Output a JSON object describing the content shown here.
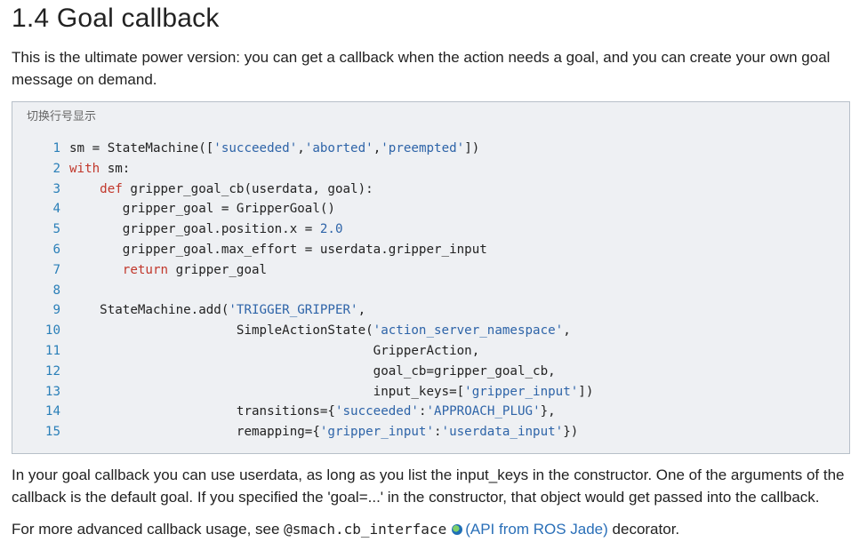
{
  "heading": "1.4 Goal callback",
  "intro": "This is the ultimate power version: you can get a callback when the action needs a goal, and you can create your own goal message on demand.",
  "code_toggle": "切换行号显示",
  "code_lines": [
    {
      "n": "1",
      "tokens": [
        [
          "t",
          "sm = StateMachine(["
        ],
        [
          "s",
          "'succeeded'"
        ],
        [
          "t",
          ","
        ],
        [
          "s",
          "'aborted'"
        ],
        [
          "t",
          ","
        ],
        [
          "s",
          "'preempted'"
        ],
        [
          "t",
          "])"
        ]
      ]
    },
    {
      "n": "2",
      "tokens": [
        [
          "k",
          "with"
        ],
        [
          "t",
          " sm:"
        ]
      ]
    },
    {
      "n": "3",
      "tokens": [
        [
          "t",
          "    "
        ],
        [
          "k",
          "def"
        ],
        [
          "t",
          " gripper_goal_cb(userdata, goal):"
        ]
      ]
    },
    {
      "n": "4",
      "tokens": [
        [
          "t",
          "       gripper_goal = GripperGoal()"
        ]
      ]
    },
    {
      "n": "5",
      "tokens": [
        [
          "t",
          "       gripper_goal.position.x = "
        ],
        [
          "n",
          "2.0"
        ]
      ]
    },
    {
      "n": "6",
      "tokens": [
        [
          "t",
          "       gripper_goal.max_effort = userdata.gripper_input"
        ]
      ]
    },
    {
      "n": "7",
      "tokens": [
        [
          "t",
          "       "
        ],
        [
          "k",
          "return"
        ],
        [
          "t",
          " gripper_goal"
        ]
      ]
    },
    {
      "n": "8",
      "tokens": []
    },
    {
      "n": "9",
      "tokens": [
        [
          "t",
          "    StateMachine.add("
        ],
        [
          "s",
          "'TRIGGER_GRIPPER'"
        ],
        [
          "t",
          ","
        ]
      ]
    },
    {
      "n": "10",
      "tokens": [
        [
          "t",
          "                      SimpleActionState("
        ],
        [
          "s",
          "'action_server_namespace'"
        ],
        [
          "t",
          ","
        ]
      ]
    },
    {
      "n": "11",
      "tokens": [
        [
          "t",
          "                                        GripperAction,"
        ]
      ]
    },
    {
      "n": "12",
      "tokens": [
        [
          "t",
          "                                        goal_cb=gripper_goal_cb,"
        ]
      ]
    },
    {
      "n": "13",
      "tokens": [
        [
          "t",
          "                                        input_keys=["
        ],
        [
          "s",
          "'gripper_input'"
        ],
        [
          "t",
          "])"
        ]
      ]
    },
    {
      "n": "14",
      "tokens": [
        [
          "t",
          "                      transitions={"
        ],
        [
          "s",
          "'succeeded'"
        ],
        [
          "t",
          ":"
        ],
        [
          "s",
          "'APPROACH_PLUG'"
        ],
        [
          "t",
          "},"
        ]
      ]
    },
    {
      "n": "15",
      "tokens": [
        [
          "t",
          "                      remapping={"
        ],
        [
          "s",
          "'gripper_input'"
        ],
        [
          "t",
          ":"
        ],
        [
          "s",
          "'userdata_input'"
        ],
        [
          "t",
          "})"
        ]
      ]
    }
  ],
  "para2": "In your goal callback you can use userdata, as long as you list the input_keys in the constructor. One of the arguments of the callback is the default goal. If you specified the 'goal=...' in the constructor, that object would get passed into the callback.",
  "para3": {
    "before": "For more advanced callback usage, see ",
    "code": "@smach.cb_interface",
    "link": "(API from ROS Jade)",
    "after": " decorator."
  },
  "colors": {
    "keyword": "#c1372b",
    "string": "#2e64a8",
    "line_number": "#2a7fb8",
    "code_bg": "#eef0f3",
    "link": "#2a6fb8"
  }
}
